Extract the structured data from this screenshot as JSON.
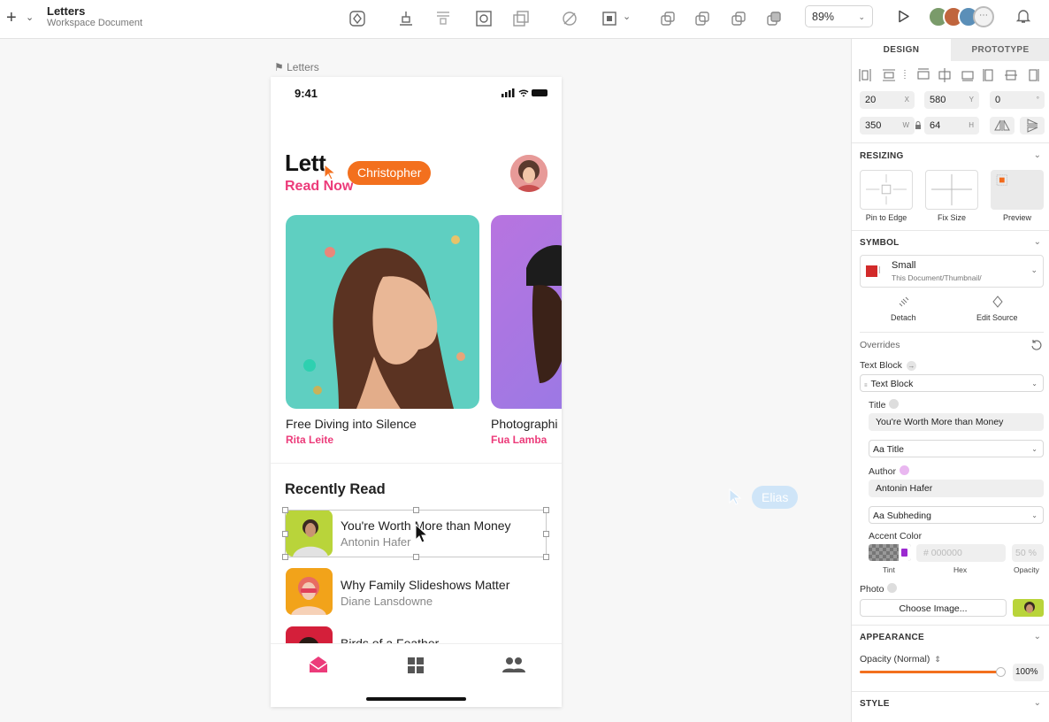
{
  "toolbar": {
    "doc_title": "Letters",
    "doc_subtitle": "Workspace Document",
    "zoom": "89%",
    "icons": [
      "create-symbol-icon",
      "align-bottom-icon",
      "distribute-icon",
      "mask-icon",
      "scale-icon",
      "slice-icon",
      "frame-icon",
      "union-icon",
      "subtract-icon",
      "intersect-icon",
      "difference-icon",
      "play-icon",
      "bell-icon"
    ]
  },
  "canvas": {
    "artboard_label": "Letters",
    "collaborator_1": "Christopher",
    "collaborator_2": "Elias"
  },
  "app": {
    "time": "9:41",
    "title": "Lett",
    "subtitle": "Read Now",
    "cards": [
      {
        "title": "Free Diving into Silence",
        "author": "Rita Leite"
      },
      {
        "title": "Photographi",
        "author": "Fua Lamba"
      }
    ],
    "section_title": "Recently Read",
    "rows": [
      {
        "title": "You're Worth More than Money",
        "author": "Antonin Hafer"
      },
      {
        "title": "Why Family Slideshows Matter",
        "author": "Diane Lansdowne"
      },
      {
        "title": "Birds of a Feather",
        "author": ""
      }
    ],
    "accent": "#ec3b7a"
  },
  "panel": {
    "tabs": {
      "design": "DESIGN",
      "prototype": "PROTOTYPE"
    },
    "x": "20",
    "y": "580",
    "rotation": "0",
    "w": "350",
    "h": "64",
    "units": {
      "x": "X",
      "y": "Y",
      "rot": "°",
      "w": "W",
      "h": "H"
    },
    "resizing": {
      "title": "RESIZING",
      "pin": "Pin to Edge",
      "fix": "Fix Size",
      "preview": "Preview"
    },
    "symbol": {
      "title": "SYMBOL",
      "name": "Small",
      "path": "This Document/Thumbnail/",
      "detach": "Detach",
      "edit_source": "Edit Source"
    },
    "overrides": {
      "title": "Overrides",
      "text_block_label": "Text Block",
      "text_block_value": "Text Block",
      "title_label": "Title",
      "title_value": "You're Worth More than Money",
      "title_style": "Aa Title",
      "author_label": "Author",
      "author_value": "Antonin Hafer",
      "author_style": "Aa Subheding",
      "accent_label": "Accent Color",
      "hex_placeholder": "# 000000",
      "opacity_placeholder": "50 %",
      "tint": "Tint",
      "hex": "Hex",
      "opacity": "Opacity",
      "photo_label": "Photo",
      "choose_image": "Choose Image..."
    },
    "appearance": {
      "title": "APPEARANCE",
      "opacity_label": "Opacity (Normal)",
      "opacity_value": "100%",
      "opacity_fraction": 1.0
    },
    "style": {
      "title": "STYLE"
    }
  }
}
